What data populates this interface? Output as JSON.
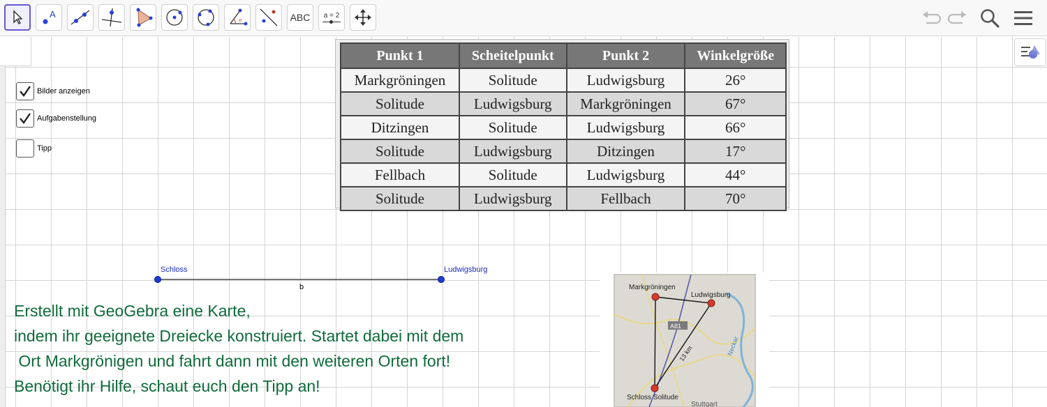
{
  "toolbar": {
    "tools": [
      {
        "name": "move-tool"
      },
      {
        "name": "point-tool",
        "label": "A"
      },
      {
        "name": "line-tool"
      },
      {
        "name": "perpendicular-line-tool"
      },
      {
        "name": "polygon-tool"
      },
      {
        "name": "circle-center-point-tool"
      },
      {
        "name": "circle-three-points-tool"
      },
      {
        "name": "angle-tool"
      },
      {
        "name": "reflect-tool"
      },
      {
        "name": "text-tool",
        "label": "ABC"
      },
      {
        "name": "slider-tool",
        "label": "a = 2"
      },
      {
        "name": "move-graphics-view-tool"
      }
    ],
    "right": [
      "undo-icon",
      "redo-icon",
      "search-icon",
      "menu-icon"
    ]
  },
  "checkboxes": [
    {
      "label": "Bilder anzeigen",
      "checked": true
    },
    {
      "label": "Aufgabenstellung",
      "checked": true
    },
    {
      "label": "Tipp",
      "checked": false
    }
  ],
  "table": {
    "headers": [
      "Punkt 1",
      "Scheitelpunkt",
      "Punkt 2",
      "Winkelgröße"
    ],
    "rows": [
      [
        "Markgröningen",
        "Solitude",
        "Ludwigsburg",
        "26°"
      ],
      [
        "Solitude",
        "Ludwigsburg",
        "Markgröningen",
        "67°"
      ],
      [
        "Ditzingen",
        "Solitude",
        "Ludwigsburg",
        "66°"
      ],
      [
        "Solitude",
        "Ludwigsburg",
        "Ditzingen",
        "17°"
      ],
      [
        "Fellbach",
        "Solitude",
        "Ludwigsburg",
        "44°"
      ],
      [
        "Solitude",
        "Ludwigsburg",
        "Fellbach",
        "70°"
      ]
    ]
  },
  "segment": {
    "point1": "Schloss",
    "point2": "Ludwigsburg",
    "label": "b"
  },
  "task": {
    "lines": [
      "Erstellt mit GeoGebra eine Karte,",
      "indem ihr geeignete Dreiecke konstruiert. Startet dabei mit dem",
      " Ort Markgrönigen und fahrt dann mit den weiteren Orten fort!",
      "Benötigt ihr Hilfe, schaut euch den Tipp an!"
    ]
  },
  "map": {
    "labels": [
      "Markgröningen",
      "Ludwigsburg",
      "A81",
      "13 km",
      "Neckar",
      "Schloss Solitude",
      "Stuttgart"
    ]
  },
  "colors": {
    "accent": "#6557d2",
    "point": "#1f3bd6",
    "task_text": "#0f6b3a",
    "map_point": "#d83a2e"
  }
}
